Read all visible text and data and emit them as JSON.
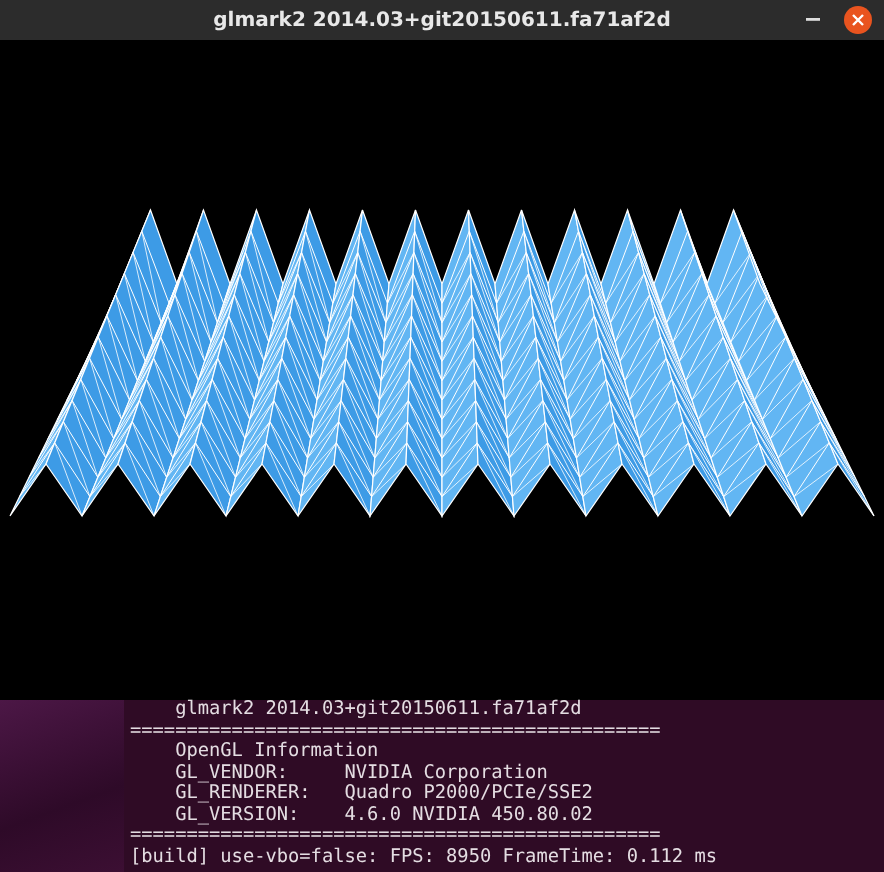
{
  "window": {
    "title": "glmark2 2014.03+git20150611.fa71af2d"
  },
  "terminal": {
    "lines": [
      "    glmark2 2014.03+git20150611.fa71af2d",
      "===============================================",
      "    OpenGL Information",
      "    GL_VENDOR:     NVIDIA Corporation",
      "    GL_RENDERER:   Quadro P2000/PCIe/SSE2",
      "    GL_VERSION:    4.6.0 NVIDIA 450.80.02",
      "===============================================",
      "[build] use-vbo=false: FPS: 8950 FrameTime: 0.112 ms"
    ]
  }
}
